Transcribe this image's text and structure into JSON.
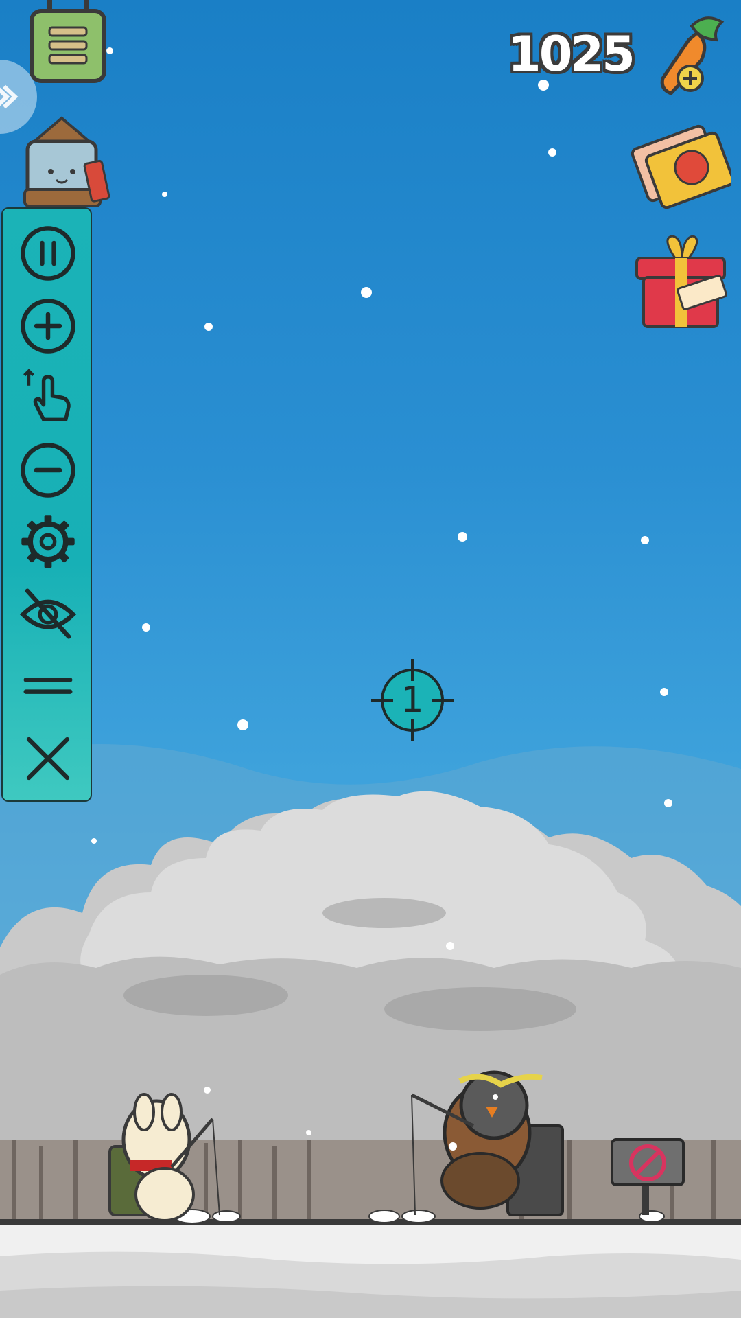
{
  "hud": {
    "carrot_count": "1025",
    "buttons": {
      "menu": "menu-button",
      "side_arrow": "expand-arrow-icon",
      "shrine": "lucky-charm-character",
      "add_carrot": "carrot-add-icon",
      "tickets": "ticket-icon",
      "gift": "starter-gift-box"
    }
  },
  "toolbar": {
    "items": [
      {
        "icon": "pause-icon"
      },
      {
        "icon": "plus-circle-icon"
      },
      {
        "icon": "tap-gesture-icon"
      },
      {
        "icon": "minus-circle-icon"
      },
      {
        "icon": "gear-icon"
      },
      {
        "icon": "eye-off-icon"
      },
      {
        "icon": "drag-handle-icon"
      },
      {
        "icon": "close-icon"
      }
    ]
  },
  "crosshair": {
    "label": "1"
  },
  "colors": {
    "toolbar": "#1bb3b7",
    "sky_top": "#1a7fc6",
    "sky_bottom": "#7dc3e8",
    "icon_ink": "#1e2a2a"
  }
}
